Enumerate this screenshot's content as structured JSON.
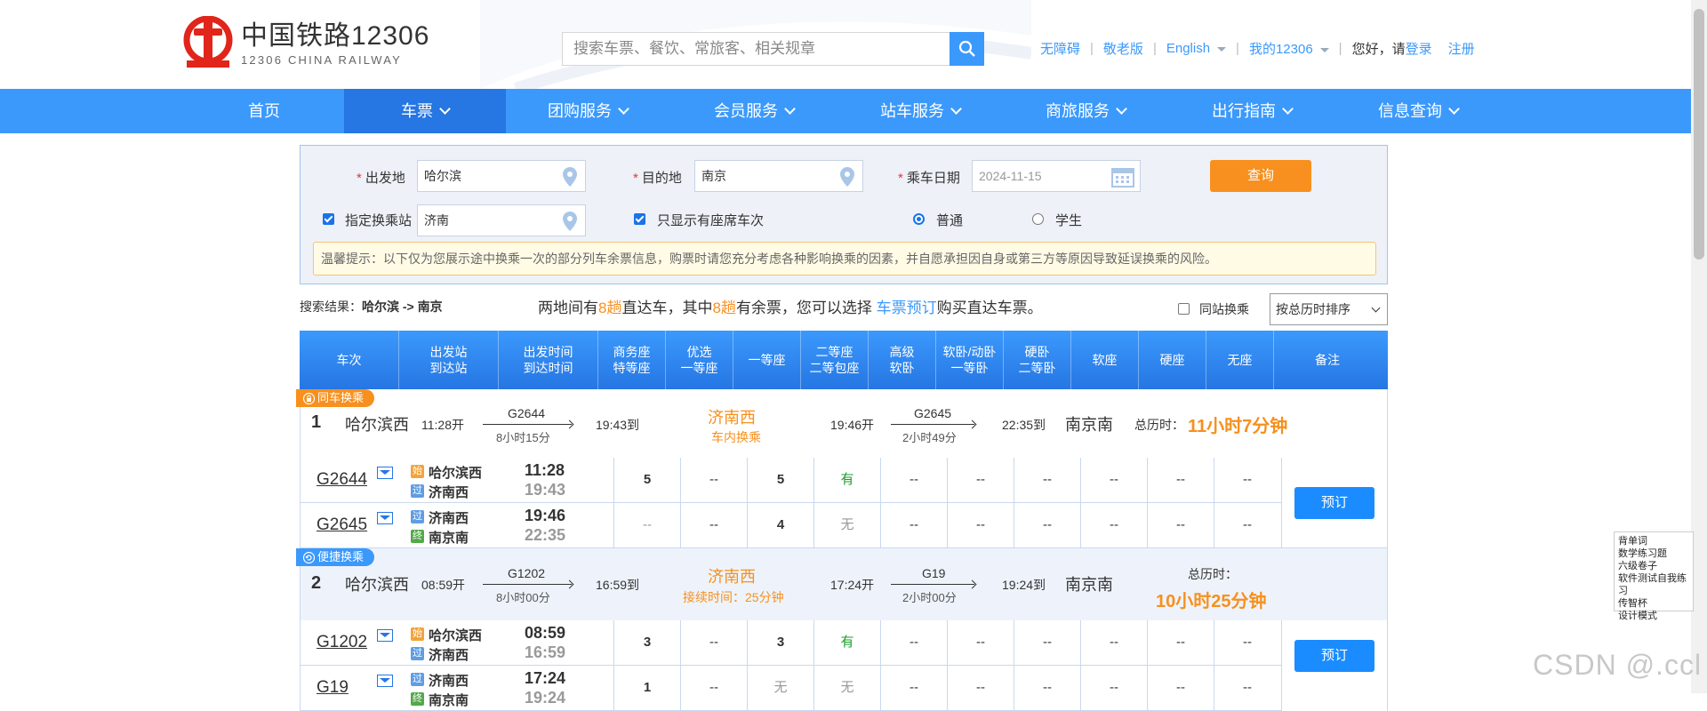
{
  "header": {
    "logo_cn": "中国铁路12306",
    "logo_en": "12306 CHINA RAILWAY",
    "search_placeholder": "搜索车票、餐饮、常旅客、相关规章",
    "links": {
      "accessible": "无障碍",
      "elder": "敬老版",
      "english": "English",
      "my12306": "我的12306",
      "greeting": "您好，请",
      "login": "登录",
      "register": "注册"
    }
  },
  "nav": [
    "首页",
    "车票",
    "团购服务",
    "会员服务",
    "站车服务",
    "商旅服务",
    "出行指南",
    "信息查询"
  ],
  "query": {
    "from_label": "出发地",
    "from_value": "哈尔滨",
    "to_label": "目的地",
    "to_value": "南京",
    "date_label": "乘车日期",
    "date_value": "2024-11-15",
    "query_button": "查询",
    "transfer_label": "指定换乘站",
    "transfer_value": "济南",
    "seat_only_label": "只显示有座席车次",
    "normal_label": "普通",
    "student_label": "学生",
    "tip": "温馨提示：以下仅为您展示途中换乘一次的部分列车余票信息，购票时请您充分考虑各种影响换乘的因素，并自愿承担因自身或第三方等原因导致延误换乘的风险。"
  },
  "results": {
    "label": "搜索结果：",
    "route": "哈尔滨 -> 南京",
    "msg_1": "两地间有",
    "direct_count": "8趟",
    "msg_2": "直达车，其中",
    "avail_count": "8趟",
    "msg_3": "有余票，您可以选择",
    "msg_link": "车票预订",
    "msg_4": "购买直达车票。",
    "same_station": "同站换乘",
    "sort": "按总历时排序"
  },
  "table_headers": [
    [
      "车次"
    ],
    [
      "出发站",
      "到达站"
    ],
    [
      "出发时间",
      "到达时间"
    ],
    [
      "商务座",
      "特等座"
    ],
    [
      "优选",
      "一等座"
    ],
    [
      "一等座"
    ],
    [
      "二等座",
      "二等包座"
    ],
    [
      "高级",
      "软卧"
    ],
    [
      "软卧/动卧",
      "一等卧"
    ],
    [
      "硬卧",
      "二等卧"
    ],
    [
      "软座"
    ],
    [
      "硬座"
    ],
    [
      "无座"
    ],
    [
      "备注"
    ]
  ],
  "options": [
    {
      "badge": "同车换乘",
      "num": "1",
      "from": "哈尔滨西",
      "dep1": "11:28开",
      "train1": "G2644",
      "dur1": "8小时15分",
      "arr1": "19:43到",
      "transfer": "济南西",
      "transfer_note": "车内换乘",
      "dep2": "19:46开",
      "train2": "G2645",
      "dur2": "2小时49分",
      "arr2": "22:35到",
      "to": "南京南",
      "total_label": "总历时：",
      "total": "11小时7分钟",
      "book": "预订",
      "rows": [
        {
          "train": "G2644",
          "st1_tag": "始",
          "st1": "哈尔滨西",
          "st2_tag": "过",
          "st2": "济南西",
          "dep": "11:28",
          "arr": "19:43",
          "seats": [
            "5",
            "--",
            "5",
            "有",
            "--",
            "--",
            "--",
            "--",
            "--",
            "--"
          ]
        },
        {
          "train": "G2645",
          "st1_tag": "过",
          "st1": "济南西",
          "st2_tag": "终",
          "st2": "南京南",
          "dep": "19:46",
          "arr": "22:35",
          "seats": [
            "--",
            "--",
            "4",
            "无",
            "--",
            "--",
            "--",
            "--",
            "--",
            "--"
          ]
        }
      ]
    },
    {
      "badge": "便捷换乘",
      "num": "2",
      "from": "哈尔滨西",
      "dep1": "08:59开",
      "train1": "G1202",
      "dur1": "8小时00分",
      "arr1": "16:59到",
      "transfer": "济南西",
      "transfer_note": "接续时间：25分钟",
      "dep2": "17:24开",
      "train2": "G19",
      "dur2": "2小时00分",
      "arr2": "19:24到",
      "to": "南京南",
      "total_label": "总历时：",
      "total": "10小时25分钟",
      "book": "预订",
      "rows": [
        {
          "train": "G1202",
          "st1_tag": "始",
          "st1": "哈尔滨西",
          "st2_tag": "过",
          "st2": "济南西",
          "dep": "08:59",
          "arr": "16:59",
          "seats": [
            "3",
            "--",
            "3",
            "有",
            "--",
            "--",
            "--",
            "--",
            "--",
            "--"
          ]
        },
        {
          "train": "G19",
          "st1_tag": "过",
          "st1": "济南西",
          "st2_tag": "终",
          "st2": "南京南",
          "dep": "17:24",
          "arr": "19:24",
          "seats": [
            "1",
            "--",
            "无",
            "无",
            "--",
            "--",
            "--",
            "--",
            "--",
            "--"
          ]
        }
      ]
    }
  ],
  "side_popup": [
    "背单词",
    "数学练习题",
    "六级卷子",
    "软件测试自我练习",
    "传智杯",
    "设计模式"
  ],
  "watermark": "CSDN @.ccl",
  "colors": {
    "brand_blue": "#3b99fc",
    "nav_active": "#2676e3",
    "orange": "#f7901e",
    "logo_red": "#e1251b"
  }
}
